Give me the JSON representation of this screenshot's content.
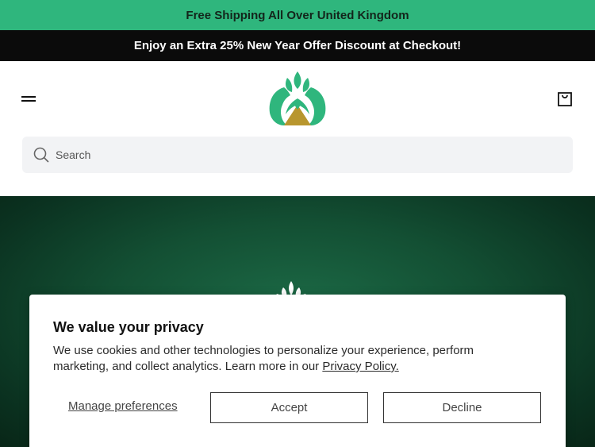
{
  "announcement": {
    "top_text": "Free Shipping All Over United Kingdom",
    "offer_text": "Enjoy an Extra 25% New Year Offer Discount at Checkout!"
  },
  "header": {
    "menu_icon": "hamburger-menu-icon",
    "logo_icon": "lotus-logo-icon",
    "cart_icon": "shopping-bag-icon"
  },
  "search": {
    "placeholder": "Search",
    "icon": "search-icon"
  },
  "cookie_banner": {
    "title": "We value your privacy",
    "body": "We use cookies and other technologies to personalize your experience, perform marketing, and collect analytics. Learn more in our ",
    "link_text": "Privacy Policy.",
    "manage_label": "Manage preferences",
    "accept_label": "Accept",
    "decline_label": "Decline"
  },
  "colors": {
    "brand_green": "#2fb67d",
    "logo_gold": "#b8962e",
    "hero_green": "#134f33"
  }
}
